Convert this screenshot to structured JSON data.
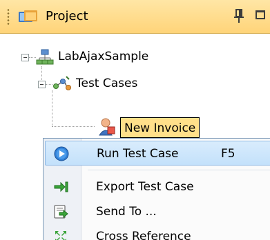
{
  "panel": {
    "title": "Project",
    "icons": {
      "title": "project-folder-icon",
      "pin": "pin-icon",
      "maximize": "maximize-icon"
    }
  },
  "tree": {
    "root": {
      "label": "LabAjaxSample",
      "icon": "project-network-icon",
      "expanded": true
    },
    "folder": {
      "label": "Test Cases",
      "icon": "test-cases-icon",
      "expanded": true
    },
    "selected_item": {
      "label": "New Invoice",
      "icon": "test-case-user-icon",
      "selected": true
    }
  },
  "context_menu": {
    "items": [
      {
        "label": "Run Test Case",
        "shortcut": "F5",
        "icon": "run-play-icon",
        "highlighted": true
      },
      {
        "label": "Export Test Case",
        "shortcut": "",
        "icon": "export-arrow-icon"
      },
      {
        "label": "Send To ...",
        "shortcut": "",
        "icon": "send-to-icon"
      },
      {
        "label": "Cross Reference",
        "shortcut": "",
        "icon": "cross-reference-icon"
      }
    ]
  },
  "colors": {
    "titlebar": "#ffd479",
    "selection": "#ffe08a",
    "menu_highlight": "#c3e1fb",
    "run_icon": "#2f7fd6",
    "export_icon": "#3aa43a"
  }
}
